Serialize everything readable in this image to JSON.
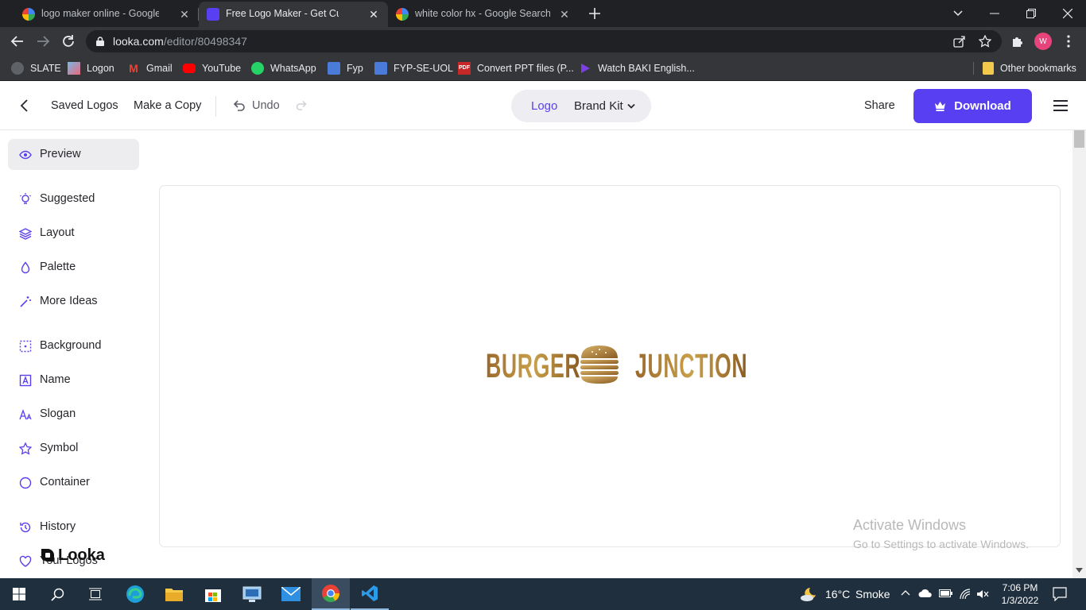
{
  "browser": {
    "tabs": [
      {
        "title": "logo maker online - Google Sear",
        "active": false
      },
      {
        "title": "Free Logo Maker - Get Custom Lo",
        "active": true
      },
      {
        "title": "white color hx - Google Search",
        "active": false
      }
    ],
    "url_host": "looka.com",
    "url_path": "/editor/80498347",
    "profile_initial": "W",
    "bookmarks": [
      {
        "label": "SLATE",
        "icon": "slate-icon"
      },
      {
        "label": "Logon",
        "icon": "logon-icon"
      },
      {
        "label": "Gmail",
        "icon": "gmail-icon"
      },
      {
        "label": "YouTube",
        "icon": "youtube-icon"
      },
      {
        "label": "WhatsApp",
        "icon": "whatsapp-icon"
      },
      {
        "label": "Fyp",
        "icon": "fyp-icon"
      },
      {
        "label": "FYP-SE-UOL",
        "icon": "fyp-se-uol-icon"
      },
      {
        "label": "Convert PPT files (P...",
        "icon": "pdf-icon",
        "icon_text": "PDF"
      },
      {
        "label": "Watch BAKI English...",
        "icon": "play-icon"
      }
    ],
    "other_bookmarks": "Other bookmarks"
  },
  "header": {
    "saved_logos": "Saved Logos",
    "make_copy": "Make a Copy",
    "undo": "Undo",
    "toggle_logo": "Logo",
    "toggle_brand_kit": "Brand Kit",
    "share": "Share",
    "download": "Download"
  },
  "sidebar": {
    "items": [
      {
        "label": "Preview",
        "icon": "eye-icon",
        "selected": true
      },
      {
        "label": "Suggested",
        "icon": "lightbulb-icon"
      },
      {
        "label": "Layout",
        "icon": "layers-icon"
      },
      {
        "label": "Palette",
        "icon": "droplet-icon"
      },
      {
        "label": "More Ideas",
        "icon": "magic-wand-icon"
      },
      {
        "label": "Background",
        "icon": "background-grid-icon"
      },
      {
        "label": "Name",
        "icon": "name-text-icon"
      },
      {
        "label": "Slogan",
        "icon": "slogan-text-icon"
      },
      {
        "label": "Symbol",
        "icon": "star-icon"
      },
      {
        "label": "Container",
        "icon": "circle-icon"
      },
      {
        "label": "History",
        "icon": "history-icon"
      },
      {
        "label": "Your Logos",
        "icon": "heart-icon"
      }
    ],
    "brand": "Looka"
  },
  "logo": {
    "left_word": "BURGER",
    "right_word": "JUNCTION",
    "symbol": "burger-stack-icon",
    "colors": {
      "gold_dark": "#8a5b22",
      "gold_light": "#d9b46a"
    }
  },
  "accent": "#5840f2",
  "watermark": {
    "title": "Activate Windows",
    "subtitle": "Go to Settings to activate Windows."
  },
  "taskbar": {
    "weather_temp": "16°C",
    "weather_text": "Smoke",
    "time": "7:06 PM",
    "date": "1/3/2022"
  }
}
